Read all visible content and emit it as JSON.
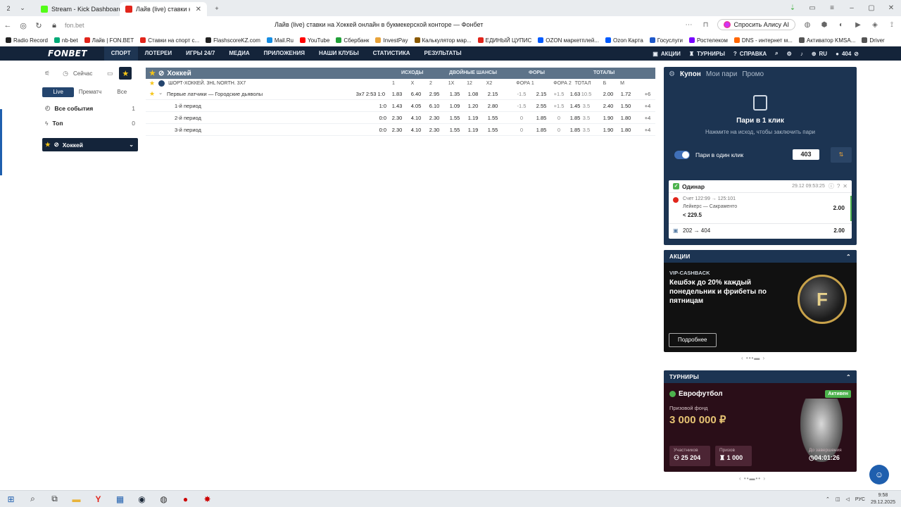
{
  "browser": {
    "tab_count": "2",
    "tabs": [
      {
        "title": "Stream - Kick Dashboard",
        "color": "#53fc18",
        "active": false
      },
      {
        "title": "Лайв (live) ставки на Хо",
        "color": "#e1251b",
        "active": true
      }
    ],
    "new_tab": "+",
    "url": "fon.bet",
    "page_title": "Лайв (live) ставки на Хоккей онлайн в букмекерской конторе — Фонбет",
    "alice_label": "Спросить Алису AI",
    "bookmarks": [
      {
        "label": "Radio Record",
        "color": "#222"
      },
      {
        "label": "nb-bet",
        "color": "#0a7"
      },
      {
        "label": "Лайв | FON.BET",
        "color": "#e1251b"
      },
      {
        "label": "Ставки на спорт с...",
        "color": "#e1251b"
      },
      {
        "label": "FlashscoreKZ.com",
        "color": "#222"
      },
      {
        "label": "Mail.Ru",
        "color": "#168de2"
      },
      {
        "label": "YouTube",
        "color": "#f00"
      },
      {
        "label": "Сбербанк",
        "color": "#21a038"
      },
      {
        "label": "InvestPay",
        "color": "#e8a33a"
      },
      {
        "label": "Калькулятор мар...",
        "color": "#8a5a00"
      },
      {
        "label": "ЕДИНЫЙ ЦУПИС",
        "color": "#e1251b"
      },
      {
        "label": "OZON маркетплей...",
        "color": "#005bff"
      },
      {
        "label": "Ozon Карта",
        "color": "#005bff"
      },
      {
        "label": "Госуслуги",
        "color": "#1e58c9"
      },
      {
        "label": "Ростелеком",
        "color": "#7700ff"
      },
      {
        "label": "DNS - интернет м...",
        "color": "#f60"
      },
      {
        "label": "Активатор KMSA...",
        "color": "#555"
      },
      {
        "label": "Driver",
        "color": "#555"
      }
    ]
  },
  "fonbet": {
    "logo": "FONBET",
    "nav": [
      "СПОРТ",
      "ЛОТЕРЕИ",
      "ИГРЫ 24/7",
      "МЕДИА",
      "ПРИЛОЖЕНИЯ",
      "НАШИ КЛУБЫ",
      "СТАТИСТИКА",
      "РЕЗУЛЬТАТЫ"
    ],
    "right": {
      "actions": "АКЦИИ",
      "tournaments": "ТУРНИРЫ",
      "help": "СПРАВКА",
      "lang": "RU",
      "balance": "404"
    }
  },
  "filters": {
    "now": "Сейчас",
    "segments": [
      "Live",
      "Прематч",
      "Все"
    ],
    "all_events": "Все события",
    "all_events_count": "1",
    "top": "Топ",
    "top_count": "0",
    "sport": "Хоккей"
  },
  "table": {
    "sport": "Хоккей",
    "groups": [
      "ИСХОДЫ",
      "ДВОЙНЫЕ ШАНСЫ",
      "ФОРЫ",
      "ТОТАЛЫ"
    ],
    "league": "ШОРТ-ХОККЕЙ. 3HL NORTH. 3X7",
    "cols": [
      "1",
      "X",
      "2",
      "1X",
      "12",
      "X2",
      "ФОРА 1",
      "",
      "ФОРА 2",
      "",
      "ТОТАЛ",
      "Б",
      "М"
    ],
    "rows": [
      {
        "name": "Первые латчики — Городские дьяволы",
        "info": "3x7  2:53  1:0",
        "cells": [
          "1.83",
          "6.40",
          "2.95",
          "1.35",
          "1.08",
          "2.15",
          "-1.5",
          "2.15",
          "+1.5",
          "1.63",
          "10.5",
          "2.00",
          "1.72"
        ],
        "more": "+6"
      },
      {
        "name": "1-й период",
        "info": "1:0",
        "cells": [
          "1.43",
          "4.05",
          "6.10",
          "1.09",
          "1.20",
          "2.80",
          "-1.5",
          "2.55",
          "+1.5",
          "1.45",
          "3.5",
          "2.40",
          "1.50"
        ],
        "more": "+4"
      },
      {
        "name": "2-й период",
        "info": "0:0",
        "cells": [
          "2.30",
          "4.10",
          "2.30",
          "1.55",
          "1.19",
          "1.55",
          "0",
          "1.85",
          "0",
          "1.85",
          "3.5",
          "1.90",
          "1.80"
        ],
        "more": "+4"
      },
      {
        "name": "3-й период",
        "info": "0:0",
        "cells": [
          "2.30",
          "4.10",
          "2.30",
          "1.55",
          "1.19",
          "1.55",
          "0",
          "1.85",
          "0",
          "1.85",
          "3.5",
          "1.90",
          "1.80"
        ],
        "more": "+4"
      }
    ]
  },
  "coupon": {
    "tabs": [
      "Купон",
      "Мои пари",
      "Промо"
    ],
    "title": "Пари в 1 клик",
    "subtitle": "Нажмите на исход, чтобы заключить пари",
    "toggle_label": "Пари в один клик",
    "amount": "403",
    "bet": {
      "type": "Одинар",
      "time": "29.12  09:53:25",
      "score": "Счет 122:99 → 125:101",
      "match": "Лейкерс — Сакраменто",
      "pick": "< 229.5",
      "odd": "2.00",
      "stake": "202 → 404",
      "total_odd": "2.00"
    }
  },
  "promo": {
    "header": "АКЦИИ",
    "tag": "VIP-CASHBACK",
    "text": "Кешбэк до 20% каждый понедельник и фрибеты по пятницам",
    "button": "Подробнее",
    "coin_letter": "F"
  },
  "tournament": {
    "header": "ТУРНИРЫ",
    "name": "Еврофутбол",
    "badge": "Активен",
    "fund_label": "Призовой фонд",
    "fund": "3 000 000 ₽",
    "participants_label": "Участников",
    "participants": "25 204",
    "prizes_label": "Призов",
    "prizes": "1 000",
    "ends_label": "До завершения",
    "ends": "04:01:26"
  },
  "tray": {
    "lang": "РУС",
    "time": "9:58",
    "date": "29.12.2025"
  }
}
